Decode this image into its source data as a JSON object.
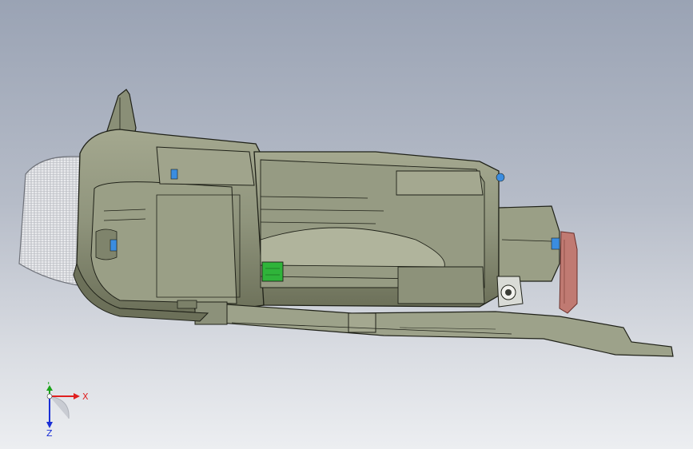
{
  "viewport": {
    "background_top": "#9aa3b4",
    "background_bottom": "#eceef1"
  },
  "model": {
    "body_color": "#8f947c",
    "shadow_color": "#5f634f",
    "light_color": "#b9bda6",
    "edge_color": "#1f2118",
    "connector_color": "#2fb43a",
    "seal_color": "#c07a72",
    "hole_color": "#3b8de0",
    "lens_color": "#e9eaec"
  },
  "triad": {
    "x_label": "X",
    "y_label": "Y",
    "z_label": "Z",
    "x_color": "#e02020",
    "y_color": "#1aa31a",
    "z_color": "#1a2fd6"
  }
}
